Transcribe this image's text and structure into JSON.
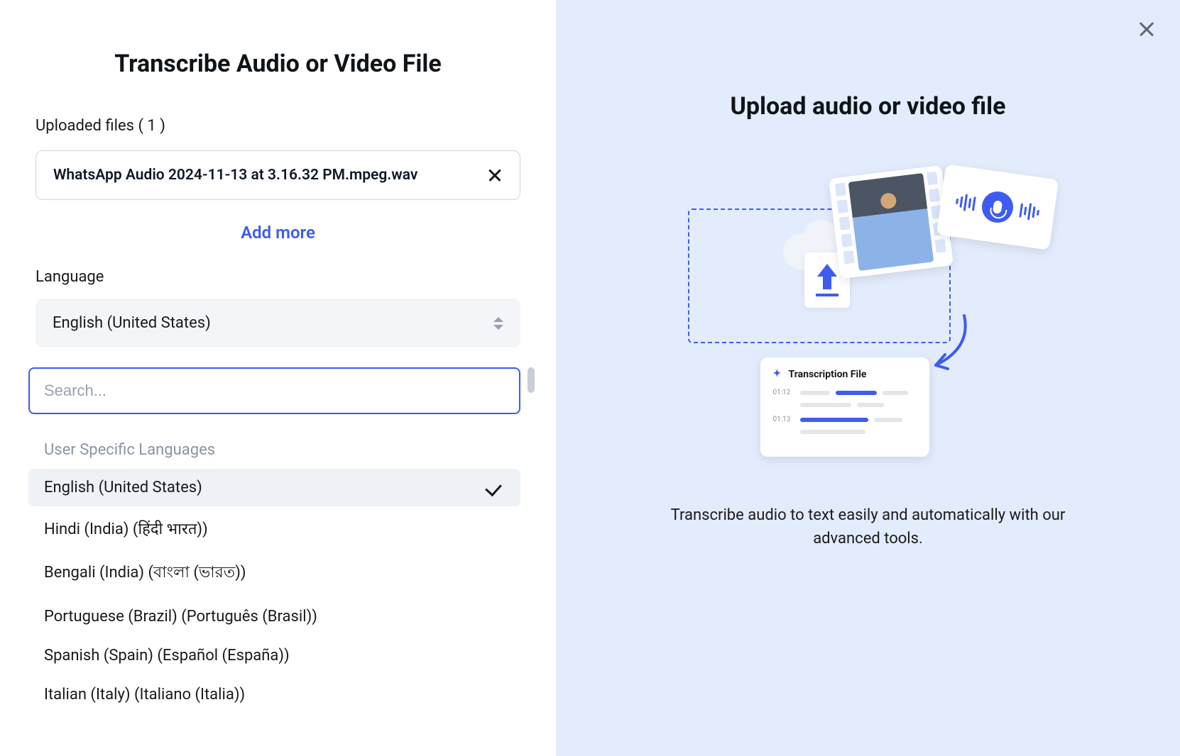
{
  "left": {
    "title": "Transcribe Audio or Video File",
    "files_label": "Uploaded files ( 1 )",
    "file_name": "WhatsApp Audio 2024-11-13 at 3.16.32 PM.mpeg.wav",
    "add_more": "Add more",
    "language_label": "Language",
    "selected_language": "English (United States)",
    "search_placeholder": "Search...",
    "group_header": "User Specific Languages",
    "options": [
      {
        "label": "English (United States)",
        "selected": true
      },
      {
        "label": "Hindi (India) (हिंदी भारत))",
        "selected": false
      },
      {
        "label": "Bengali (India) (বাংলা (ভারত))",
        "selected": false
      },
      {
        "label": "Portuguese (Brazil) (Português (Brasil))",
        "selected": false
      },
      {
        "label": "Spanish (Spain) (Español (España))",
        "selected": false
      },
      {
        "label": "Italian (Italy) (Italiano (Italia))",
        "selected": false
      }
    ]
  },
  "right": {
    "title": "Upload audio or video file",
    "description": "Transcribe audio to text easily and automatically with our advanced tools.",
    "trans_card_title": "Transcription File",
    "ts1": "01:12",
    "ts2": "01:13"
  }
}
